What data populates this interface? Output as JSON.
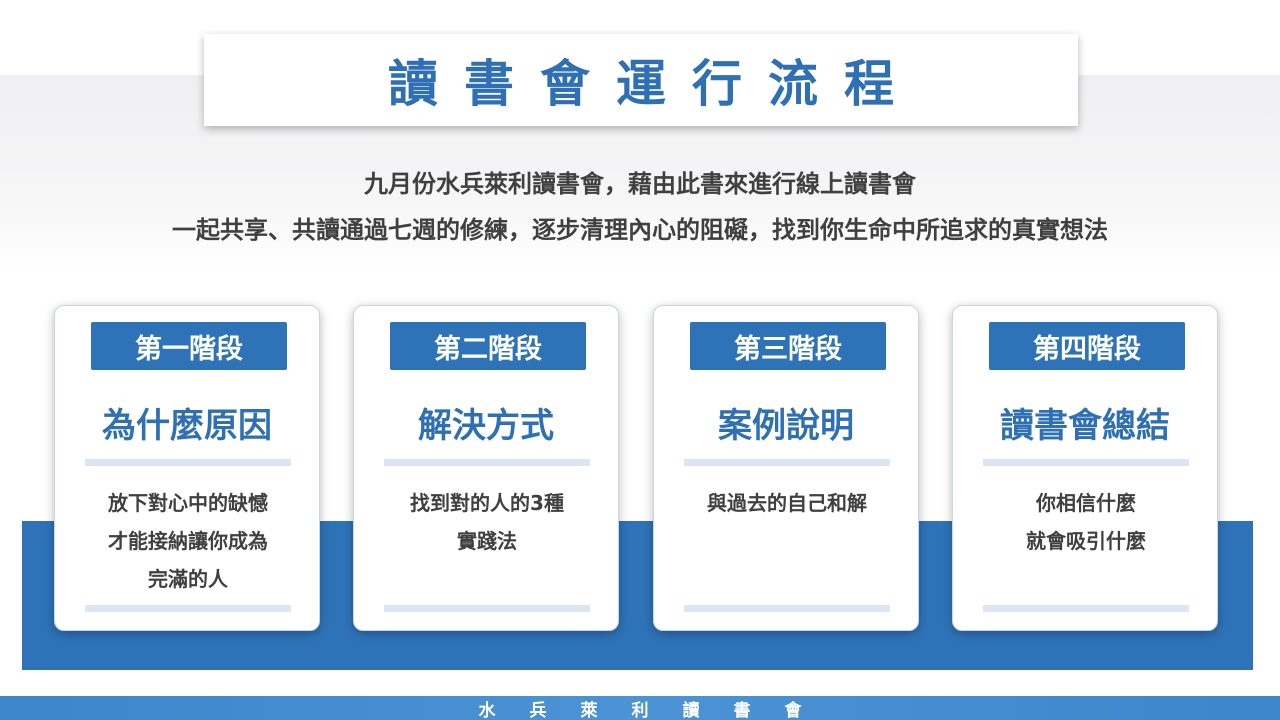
{
  "title": "讀書會運行流程",
  "subtitle": {
    "line1": "九月份水兵萊利讀書會，藉由此書來進行線上讀書會",
    "line2": "一起共享、共讀通過七週的修練，逐步清理內心的阻礙，找到你生命中所追求的真實想法"
  },
  "stages": [
    {
      "badge": "第一階段",
      "heading": "為什麼原因",
      "lines": [
        "放下對心中的缺憾",
        "才能接納讓你成為",
        "完滿的人"
      ]
    },
    {
      "badge": "第二階段",
      "heading": "解決方式",
      "lines": [
        "找到對的人的3種",
        "實踐法"
      ]
    },
    {
      "badge": "第三階段",
      "heading": "案例說明",
      "lines": [
        "與過去的自己和解"
      ]
    },
    {
      "badge": "第四階段",
      "heading": "讀書會總結",
      "lines": [
        "你相信什麼",
        "就會吸引什麼"
      ]
    }
  ],
  "footer": "水兵萊利讀書會",
  "colors": {
    "primary_blue": "#2e73b8",
    "title_blue": "#2f6fb4",
    "footer_blue": "#4c93d4",
    "divider": "#dce5f2"
  }
}
